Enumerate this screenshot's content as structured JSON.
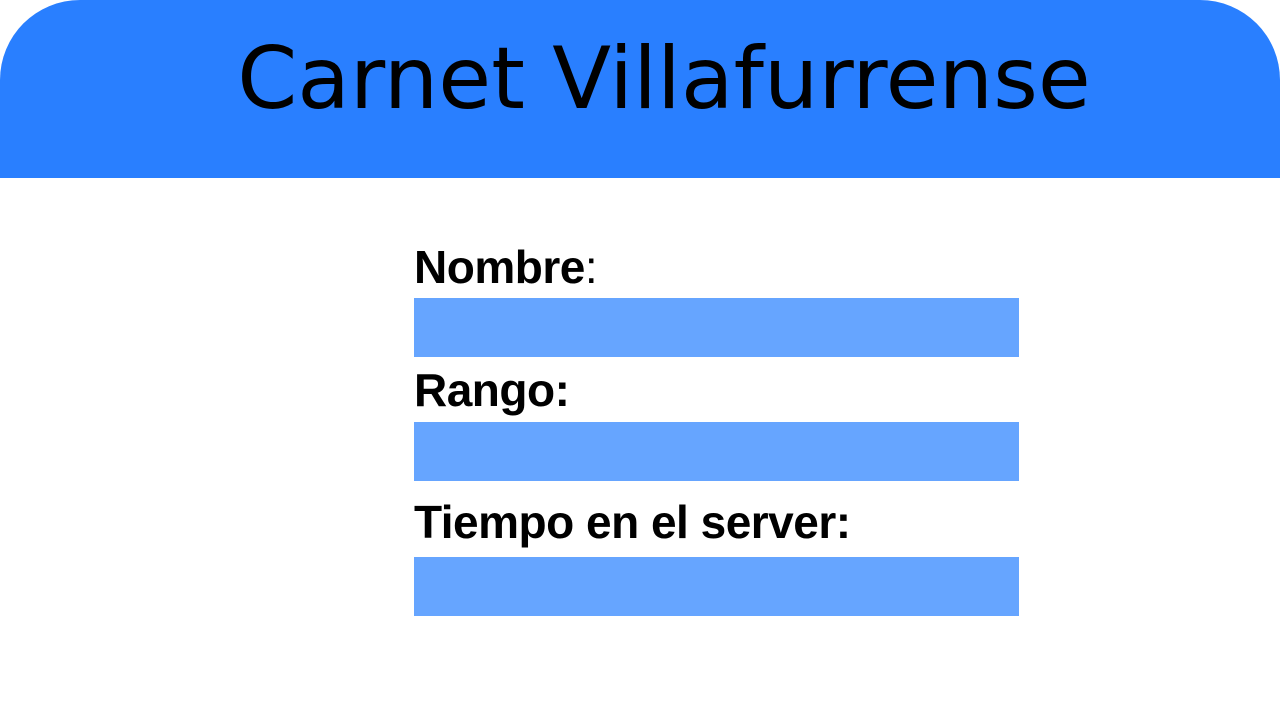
{
  "card": {
    "title": "Carnet Villafurrense",
    "colors": {
      "header": "#297fff",
      "field": "#66a5ff",
      "background": "#ffffff",
      "text": "#000000"
    },
    "fields": [
      {
        "label": "Nombre",
        "label_suffix": ":",
        "value": ""
      },
      {
        "label": "Rango:",
        "value": ""
      },
      {
        "label": "Tiempo en el server:",
        "value": ""
      }
    ]
  }
}
